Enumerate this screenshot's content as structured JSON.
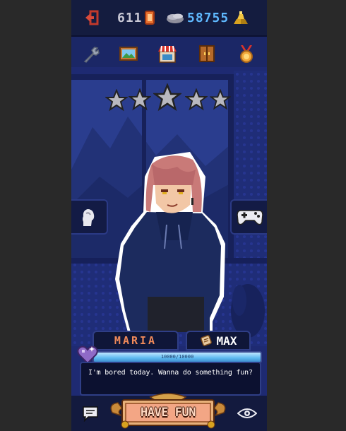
{
  "topbar": {
    "exit_icon": "exit-door-icon",
    "tickets": "611",
    "ticket_icon": "ticket-icon",
    "coin_icon": "coins-icon",
    "coins": "58755",
    "gold_icon": "gold-bars-icon"
  },
  "menu": [
    {
      "name": "wrench-icon"
    },
    {
      "name": "painting-icon"
    },
    {
      "name": "shop-icon"
    },
    {
      "name": "wardrobe-icon"
    },
    {
      "name": "medal-icon"
    }
  ],
  "stars": {
    "filled": 0,
    "total": 5
  },
  "side_left": {
    "icon": "character-silhouette-icon"
  },
  "side_right": {
    "icon": "gamepad-icon"
  },
  "character": {
    "name": "MARIA",
    "level_icon": "scroll-icon",
    "level": "MAX",
    "affection_text": "10000/10000",
    "affection_fraction": 1.0,
    "heart_icon": "purple-heart-icon"
  },
  "dialog": {
    "text": "I'm bored today. Wanna do something fun?"
  },
  "bottom": {
    "chat_icon": "chat-bubble-icon",
    "action_label": "HAVE FUN",
    "eye_icon": "eye-icon"
  },
  "colors": {
    "accent_blue": "#5fb9ff",
    "name_orange": "#f08a5a",
    "bg_blue": "#1b2766"
  }
}
